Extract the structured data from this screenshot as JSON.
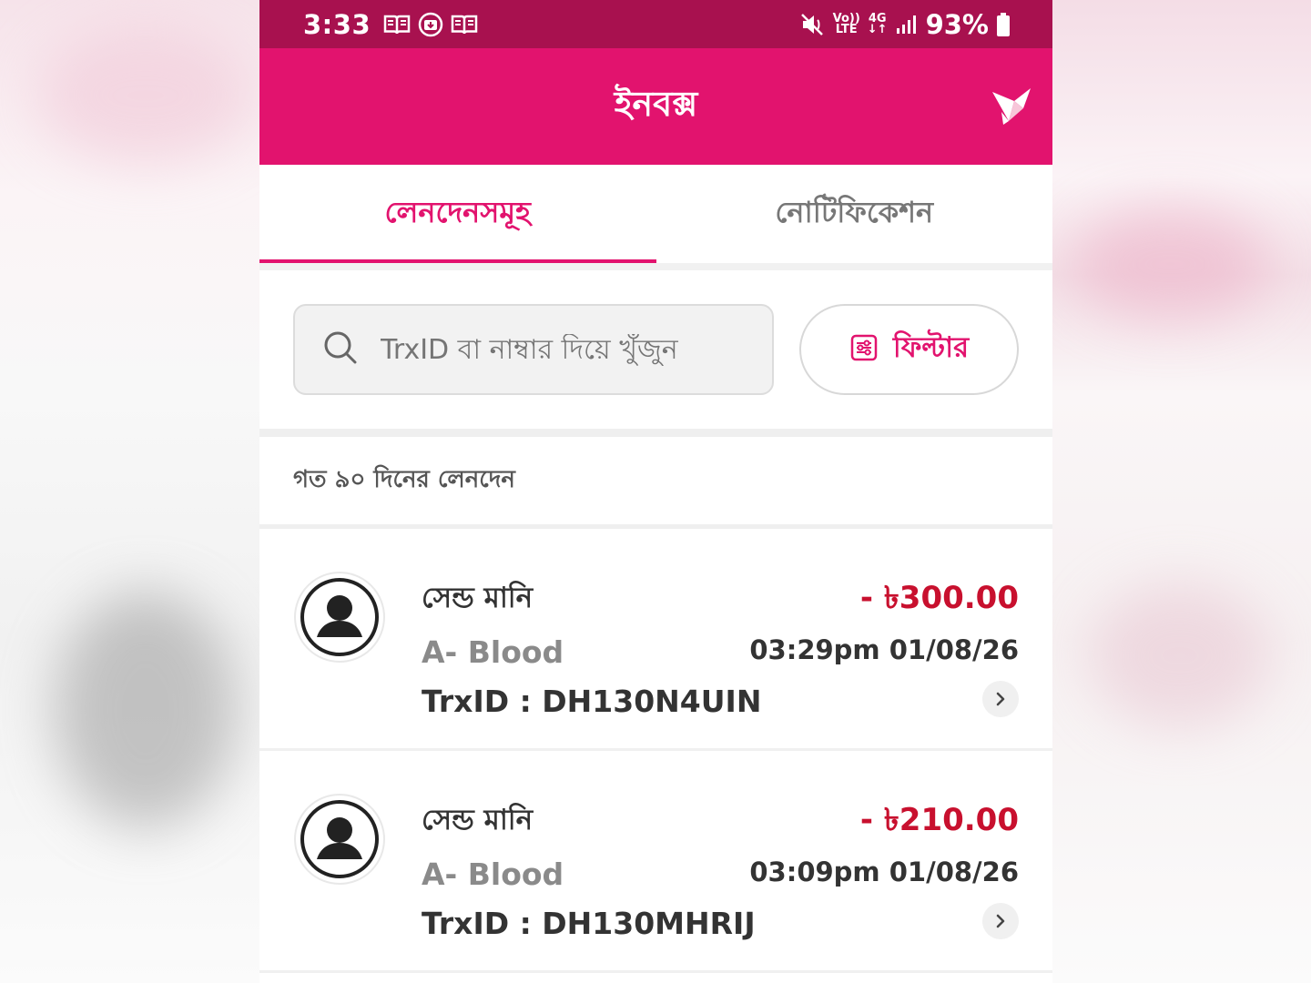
{
  "status_bar": {
    "time": "3:33",
    "battery": "93%",
    "network": "4G",
    "volte_top": "Vo))",
    "volte_bottom": "LTE"
  },
  "appbar": {
    "title": "ইনবক্স"
  },
  "tabs": [
    {
      "label": "লেনদেনসমূহ",
      "active": true
    },
    {
      "label": "নোটিফিকেশন",
      "active": false
    }
  ],
  "search": {
    "placeholder": "TrxID বা নাম্বার দিয়ে খুঁজুন"
  },
  "filter": {
    "label": "ফিল্টার"
  },
  "section": {
    "title": "গত ৯০ দিনের লেনদেন"
  },
  "transactions": [
    {
      "type": "সেন্ড মানি",
      "name": "A- Blood",
      "trx": "TrxID : DH130N4UIN",
      "amount": "- ৳300.00",
      "time": "03:29pm 01/08/26"
    },
    {
      "type": "সেন্ড মানি",
      "name": "A- Blood",
      "trx": "TrxID : DH130MHRIJ",
      "amount": "- ৳210.00",
      "time": "03:09pm 01/08/26"
    }
  ],
  "colors": {
    "brand": "#e2136e",
    "statusbar": "#a8114f",
    "debit": "#c8102e"
  }
}
